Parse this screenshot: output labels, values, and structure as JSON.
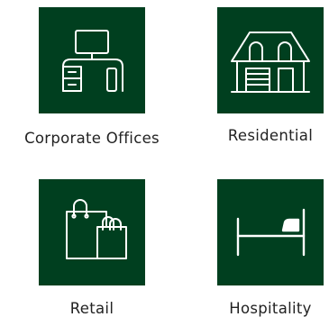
{
  "theme": {
    "tile_color": "#003f1f",
    "icon_color": "#ffffff",
    "label_color": "#222222"
  },
  "categories": [
    {
      "label": "Corporate Offices",
      "icon": "office-desk-icon"
    },
    {
      "label": "Residential",
      "icon": "house-icon"
    },
    {
      "label": "Retail",
      "icon": "shopping-bags-icon"
    },
    {
      "label": "Hospitality",
      "icon": "bed-icon"
    }
  ]
}
